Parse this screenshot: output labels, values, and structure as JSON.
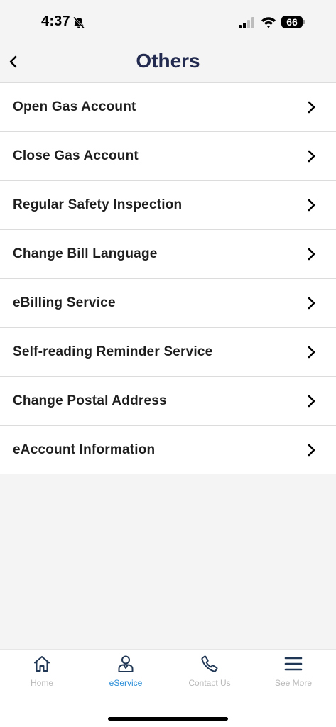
{
  "status_bar": {
    "time": "4:37",
    "battery_level": "66",
    "icons": [
      "bell-slash-icon",
      "signal-icon",
      "wifi-icon",
      "battery-icon"
    ]
  },
  "header": {
    "title": "Others",
    "back_icon": "chevron-left-icon"
  },
  "menu": {
    "items": [
      {
        "label": "Open Gas Account"
      },
      {
        "label": "Close Gas Account"
      },
      {
        "label": "Regular Safety Inspection"
      },
      {
        "label": "Change Bill Language"
      },
      {
        "label": "eBilling Service"
      },
      {
        "label": "Self-reading Reminder Service"
      },
      {
        "label": "Change Postal Address"
      },
      {
        "label": "eAccount Information"
      }
    ]
  },
  "tab_bar": {
    "tabs": [
      {
        "label": "Home",
        "icon": "home-icon",
        "active": false
      },
      {
        "label": "eService",
        "icon": "user-icon",
        "active": true
      },
      {
        "label": "Contact Us",
        "icon": "phone-icon",
        "active": false
      },
      {
        "label": "See More",
        "icon": "menu-icon",
        "active": false
      }
    ]
  },
  "colors": {
    "title": "#222a4f",
    "active_tab": "#2a8dd8",
    "inactive_tab": "#b9b9b9",
    "background": "#f4f4f4"
  }
}
